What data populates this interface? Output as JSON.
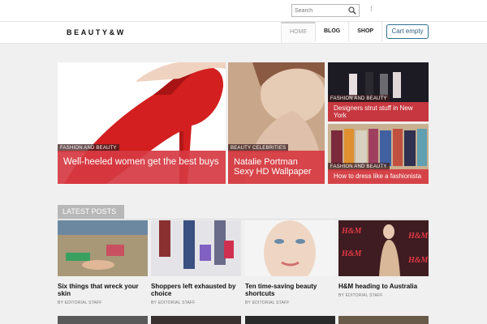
{
  "topbar": {
    "search_placeholder": "Search",
    "social_icon": "facebook-icon",
    "social_glyph": "f"
  },
  "header": {
    "logo": "BEAUTY&W",
    "nav": [
      "HOME",
      "BLOG",
      "SHOP"
    ],
    "active_nav": "HOME",
    "cart_label": "Cart empty"
  },
  "featured": [
    {
      "category": "FASHION AND BEAUTY",
      "title": "Well-heeled women get the best buys"
    },
    {
      "category": "BEAUTY CELEBRITIES",
      "title": "Natalie Portman Sexy HD Wallpaper"
    },
    {
      "category": "FASHION AND BEAUTY",
      "title": "Designers strut stuff in New York"
    },
    {
      "category": "FASHION AND BEAUTY",
      "title": "How to dress like a fashionista"
    }
  ],
  "latest": {
    "heading": "LATEST POSTS",
    "posts": [
      {
        "title": "Six things that wreck your skin",
        "author": "BY EDITORIAL STAFF"
      },
      {
        "title": "Shoppers left exhausted by choice",
        "author": "BY EDITORIAL STAFF"
      },
      {
        "title": "Ten time-saving beauty shortcuts",
        "author": "BY EDITORIAL STAFF"
      },
      {
        "title": "H&M heading to Australia",
        "author": "BY EDITORIAL STAFF"
      }
    ]
  },
  "colors": {
    "accent": "#d63a42",
    "cart_border": "#2f6f8f",
    "background": "#f0f0f0"
  }
}
